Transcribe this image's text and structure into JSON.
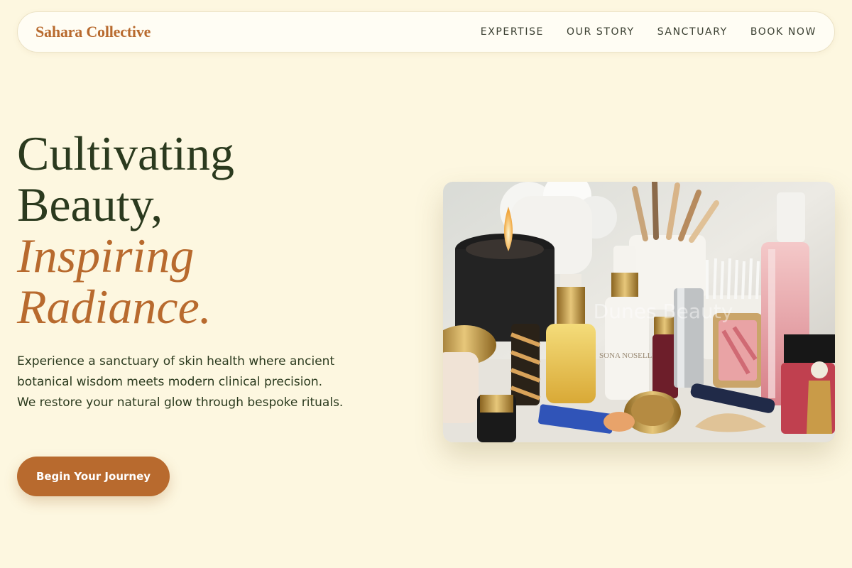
{
  "header": {
    "brand": "Sahara Collective",
    "nav": [
      {
        "label": "EXPERTISE"
      },
      {
        "label": "OUR STORY"
      },
      {
        "label": "SANCTUARY"
      },
      {
        "label": "BOOK NOW"
      }
    ]
  },
  "hero": {
    "title_lines": [
      "Cultivating",
      "Beauty,"
    ],
    "accent_lines": [
      "Inspiring",
      "Radiance."
    ],
    "description": "Experience a sanctuary of skin health where ancient botanical wisdom meets modern clinical precision. We restore your natural glow through bespoke rituals.",
    "cta_label": "Begin Your Journey",
    "image": {
      "watermark": "Dunes Beauty",
      "bottle_label_1": "SONA NOSELLI",
      "icon": "cosmetics-photo"
    }
  },
  "colors": {
    "background": "#fdf7e0",
    "accent": "#b86a2e",
    "text": "#2b3a1e"
  }
}
